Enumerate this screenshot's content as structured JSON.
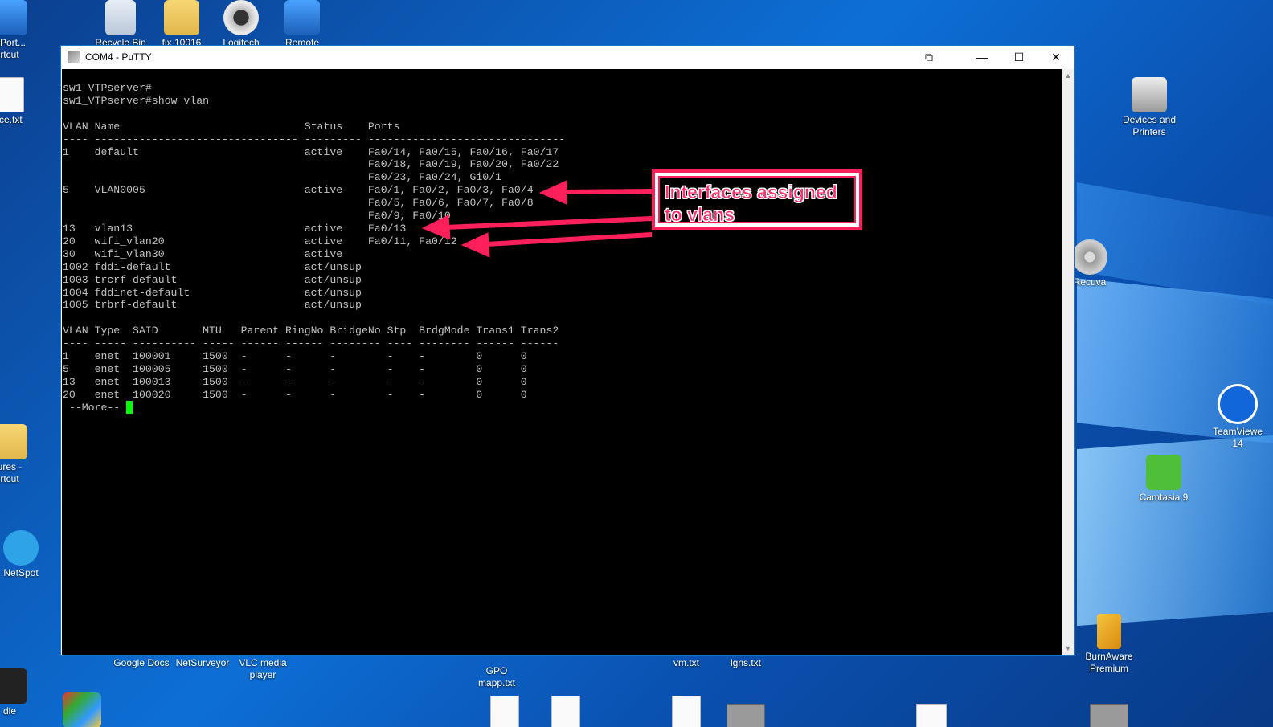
{
  "desktop": {
    "icons_top": [
      {
        "label": "PPort...\nrtcut",
        "icon": "shortcut-icon"
      },
      {
        "label": "Recycle Bin",
        "icon": "recycle-bin-icon"
      },
      {
        "label": "fix 10016",
        "icon": "folder-icon"
      },
      {
        "label": "Logitech",
        "icon": "webcam-icon"
      },
      {
        "label": "Remote",
        "icon": "remote-desktop-icon"
      }
    ],
    "left_icons": [
      {
        "label": "ice.txt",
        "icon": "text-file-icon"
      },
      {
        "label": "ures -\nrtcut",
        "icon": "pictures-shortcut-icon"
      },
      {
        "label": "NetSpot",
        "icon": "netspot-icon"
      },
      {
        "label": "dle",
        "icon": "kindle-icon"
      }
    ],
    "right_icons": [
      {
        "label": "Devices and\nPrinters",
        "icon": "printer-icon"
      },
      {
        "label": "Recuva",
        "icon": "recuva-icon"
      },
      {
        "label": "TeamViewe\n14",
        "icon": "teamviewer-icon"
      },
      {
        "label": "Camtasia 9",
        "icon": "camtasia-icon"
      },
      {
        "label": "BurnAware\nPremium",
        "icon": "burnaware-icon"
      }
    ],
    "bottom_icons": [
      {
        "label": "Google Docs",
        "icon": "google-docs-icon"
      },
      {
        "label": "NetSurveyor",
        "icon": "netsurveyor-icon"
      },
      {
        "label": "VLC media\nplayer",
        "icon": "vlc-icon"
      },
      {
        "label": "GPO\nmapp.txt",
        "icon": "text-file-icon"
      },
      {
        "label": "vm.txt",
        "icon": "text-file-icon"
      },
      {
        "label": "lgns.txt",
        "icon": "text-file-icon"
      }
    ]
  },
  "window": {
    "title": "COM4 - PuTTY",
    "controls": {
      "restore": "⧉",
      "minimize": "—",
      "maximize": "☐",
      "close": "✕"
    }
  },
  "terminal": {
    "lines": [
      "sw1_VTPserver#",
      "sw1_VTPserver#show vlan",
      "",
      "VLAN Name                             Status    Ports",
      "---- -------------------------------- --------- -------------------------------",
      "1    default                          active    Fa0/14, Fa0/15, Fa0/16, Fa0/17",
      "                                                Fa0/18, Fa0/19, Fa0/20, Fa0/22",
      "                                                Fa0/23, Fa0/24, Gi0/1",
      "5    VLAN0005                         active    Fa0/1, Fa0/2, Fa0/3, Fa0/4",
      "                                                Fa0/5, Fa0/6, Fa0/7, Fa0/8",
      "                                                Fa0/9, Fa0/10",
      "13   vlan13                           active    Fa0/13",
      "20   wifi_vlan20                      active    Fa0/11, Fa0/12",
      "30   wifi_vlan30                      active",
      "1002 fddi-default                     act/unsup",
      "1003 trcrf-default                    act/unsup",
      "1004 fddinet-default                  act/unsup",
      "1005 trbrf-default                    act/unsup",
      "",
      "VLAN Type  SAID       MTU   Parent RingNo BridgeNo Stp  BrdgMode Trans1 Trans2",
      "---- ----- ---------- ----- ------ ------ -------- ---- -------- ------ ------",
      "1    enet  100001     1500  -      -      -        -    -        0      0",
      "5    enet  100005     1500  -      -      -        -    -        0      0",
      "13   enet  100013     1500  -      -      -        -    -        0      0",
      "20   enet  100020     1500  -      -      -        -    -        0      0",
      " --More-- "
    ],
    "text_color": "#c0c0c0",
    "cursor_color": "#00ff00"
  },
  "annotation": {
    "text": "Interfaces assigned to vlans",
    "color": "#ff1f5a"
  }
}
